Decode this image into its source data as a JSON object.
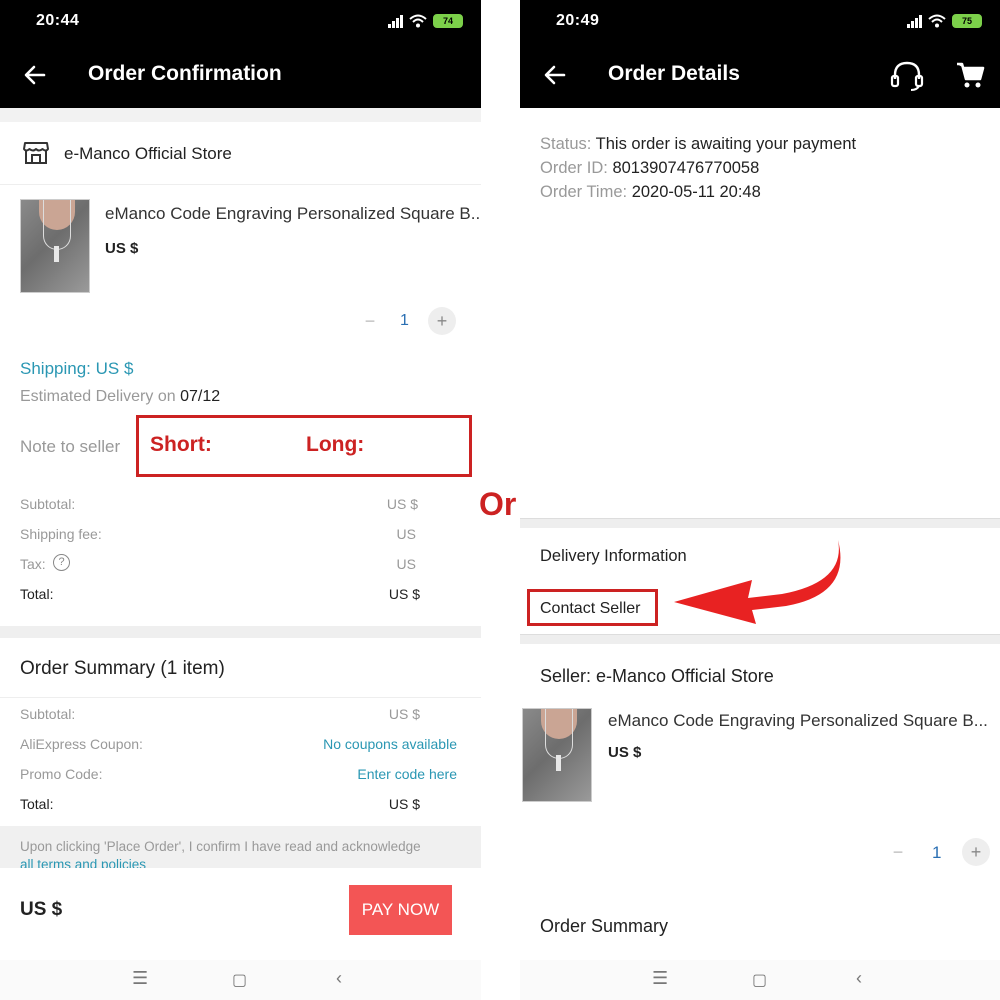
{
  "left": {
    "status_time": "20:44",
    "battery": "74",
    "title": "Order Confirmation",
    "store_name": "e-Manco Official Store",
    "product_title": "eManco Code Engraving Personalized Square B...",
    "product_price": "US $",
    "quantity": "1",
    "shipping": "Shipping: US $",
    "delivery_prefix": "Estimated Delivery on",
    "delivery_date": "07/12",
    "note_label": "Note to seller",
    "note_short": "Short:",
    "note_long": "Long:",
    "cost_rows": [
      {
        "label": "Subtotal:",
        "value": "US $"
      },
      {
        "label": "Shipping fee:",
        "value": "US"
      },
      {
        "label": "Tax:",
        "value": "US"
      },
      {
        "label": "Total:",
        "value": "US $"
      }
    ],
    "summary_title": "Order Summary (1 item)",
    "summary_rows": [
      {
        "label": "Subtotal:",
        "value": "US $"
      },
      {
        "label": "AliExpress Coupon:",
        "value": "No coupons available"
      },
      {
        "label": "Promo Code:",
        "value": "Enter code here"
      },
      {
        "label": "Total:",
        "value": "US $"
      }
    ],
    "notice": "Upon clicking 'Place Order', I confirm I have read and acknowledge",
    "notice_link": "all terms and policies",
    "bottom_price": "US $",
    "pay_button": "PAY NOW"
  },
  "connector": "Or",
  "right": {
    "status_time": "20:49",
    "battery": "75",
    "title": "Order Details",
    "status_label": "Status:",
    "status_value": "This order is awaiting your payment",
    "order_id_label": "Order ID:",
    "order_id_value": "8013907476770058",
    "order_time_label": "Order Time:",
    "order_time_value": "2020-05-11 20:48",
    "delivery_info": "Delivery Information",
    "contact_seller": "Contact Seller",
    "seller": "Seller: e-Manco Official Store",
    "product_title": "eManco Code Engraving Personalized Square B...",
    "product_price": "US $",
    "quantity": "1",
    "order_summary": "Order Summary"
  },
  "colors": {
    "accent_red": "#e03030",
    "pay_button": "#f35555",
    "link_teal": "#2a97b3",
    "annotation_red": "#cc2222"
  }
}
